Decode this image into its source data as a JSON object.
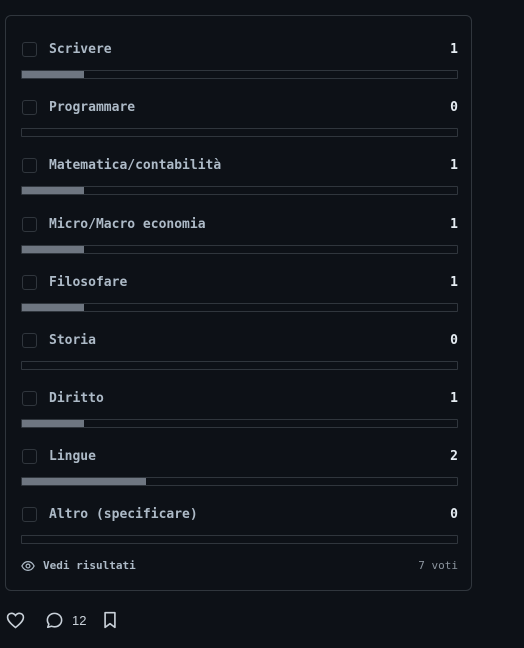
{
  "poll": {
    "options": [
      {
        "label": "Scrivere",
        "count": "1",
        "fraction": 0.1429
      },
      {
        "label": "Programmare",
        "count": "0",
        "fraction": 0
      },
      {
        "label": "Matematica/contabilità",
        "count": "1",
        "fraction": 0.1429
      },
      {
        "label": "Micro/Macro economia",
        "count": "1",
        "fraction": 0.1429
      },
      {
        "label": "Filosofare",
        "count": "1",
        "fraction": 0.1429
      },
      {
        "label": "Storia",
        "count": "0",
        "fraction": 0
      },
      {
        "label": "Diritto",
        "count": "1",
        "fraction": 0.1429
      },
      {
        "label": "Lingue",
        "count": "2",
        "fraction": 0.2857
      },
      {
        "label": "Altro (specificare)",
        "count": "0",
        "fraction": 0
      }
    ],
    "view_results_label": "Vedi risultati",
    "votes_label": "7 voti"
  },
  "actions": {
    "like_icon": "heart-icon",
    "comment_icon": "comment-icon",
    "comment_count": "12",
    "bookmark_icon": "bookmark-icon"
  },
  "colors": {
    "background": "#0d1117",
    "border": "#30363d",
    "bar_fill": "#6e7681"
  }
}
